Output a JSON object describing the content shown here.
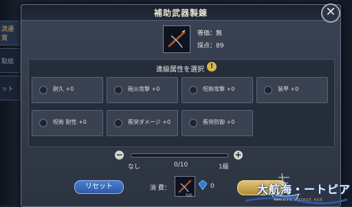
{
  "background": {
    "tabs": [
      "流通賞",
      "取総",
      "ット"
    ]
  },
  "modal": {
    "title": "補助武器製錬"
  },
  "item": {
    "price": "等価：無",
    "points": "採点：89"
  },
  "select": {
    "header": "進級属性を選択",
    "attributes": [
      "耐久 +0",
      "砲火攻撃 +0",
      "呪術攻撃 +0",
      "装甲 +0",
      "呪術 耐性 +0",
      "衝突ダメージ +0",
      "衝突防御 +0"
    ]
  },
  "slider": {
    "min_label": "なし",
    "value_label": "0/10",
    "max_label": "1級",
    "value": 0,
    "max": 10
  },
  "footer": {
    "reset_label": "リセット",
    "cost_label": "消 費：",
    "item_count": "0/0",
    "gem_count": "0"
  },
  "logo": {
    "title": "大航海・ートピア",
    "subtitle": "GOLDEN VOYAGE AGE"
  },
  "colors": {
    "accent": "#d8b64c",
    "button": "#3a6bbf"
  }
}
